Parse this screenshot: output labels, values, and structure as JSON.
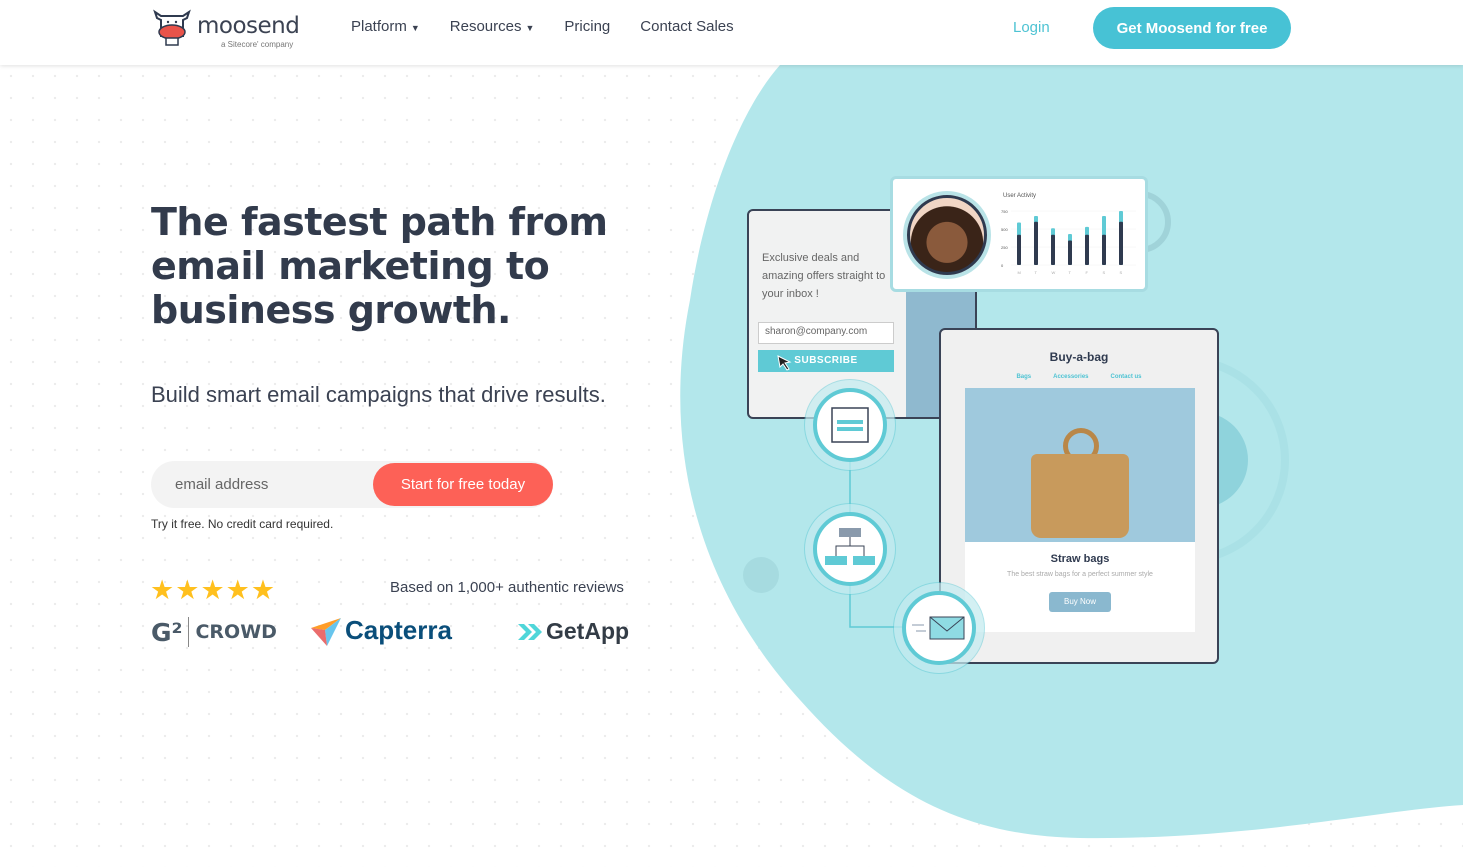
{
  "header": {
    "logo": {
      "name": "moosend",
      "tagline": "a Sitecore' company"
    },
    "nav": [
      {
        "label": "Platform",
        "dropdown": true
      },
      {
        "label": "Resources",
        "dropdown": true
      },
      {
        "label": "Pricing",
        "dropdown": false
      },
      {
        "label": "Contact Sales",
        "dropdown": false
      }
    ],
    "login": "Login",
    "cta": "Get Moosend for free"
  },
  "hero": {
    "title": "The fastest path from email marketing to business growth.",
    "subtitle": "Build smart email campaigns that drive results.",
    "email_placeholder": "email address",
    "submit": "Start for free today",
    "note": "Try it free. No credit card required.",
    "rating": {
      "stars": 5,
      "max": 5
    },
    "reviews": "Based on 1,000+ authentic reviews",
    "badges": [
      "CROWD",
      "Capterra",
      "GetApp"
    ]
  },
  "illustration": {
    "subscribe_card": {
      "text": "Exclusive deals and amazing offers straight to your inbox !",
      "email": "sharon@company.com",
      "button": "SUBSCRIBE"
    },
    "activity_card": {
      "title": "User Activity",
      "chart_data": {
        "type": "bar",
        "categories": [
          "M",
          "T",
          "W",
          "T",
          "F",
          "S",
          "S"
        ],
        "yticks": [
          "0",
          "250",
          "500",
          "750"
        ],
        "ylim": [
          0,
          750
        ],
        "series": [
          {
            "values": [
              420,
              600,
              420,
              340,
              420,
              420,
              600
            ]
          },
          {
            "values": [
              590,
              680,
              510,
              430,
              530,
              680,
              750
            ]
          }
        ]
      }
    },
    "shop_card": {
      "title": "Buy-a-bag",
      "nav": [
        "Bags",
        "Accessories",
        "Contact us"
      ],
      "product": "Straw bags",
      "description": "The best straw bags for a perfect summer style",
      "button": "Buy Now"
    }
  },
  "colors": {
    "accent": "#47c2d5",
    "cta_red": "#fd6157",
    "blob": "#b3e7eb",
    "text": "#323b4c",
    "star": "#ffc01e"
  }
}
